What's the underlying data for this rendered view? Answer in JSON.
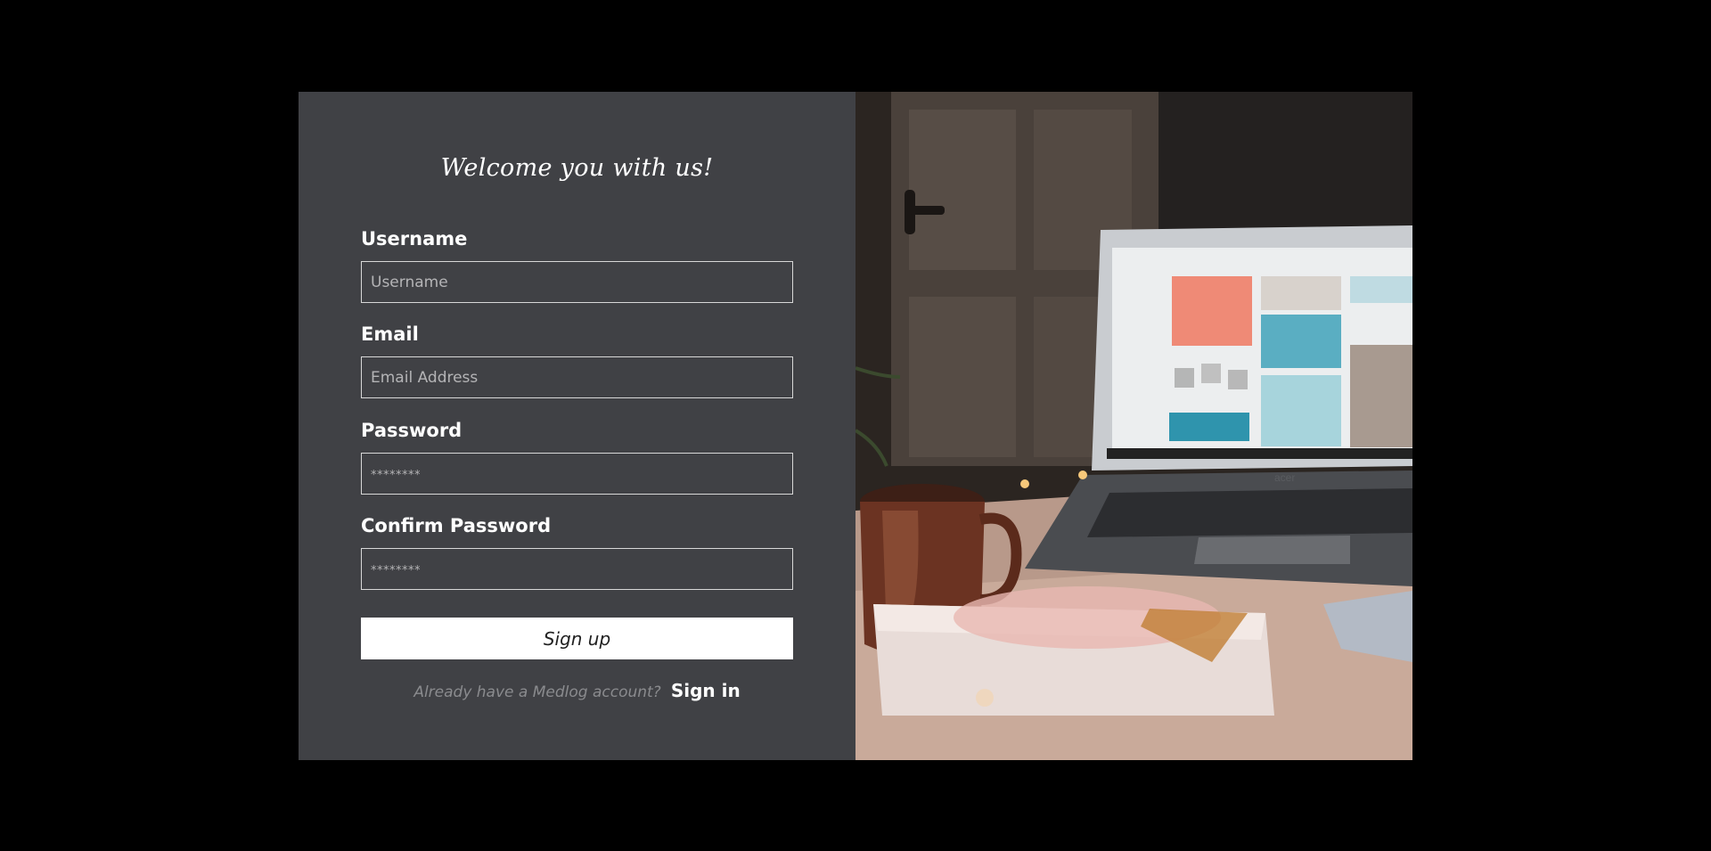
{
  "form": {
    "heading": "Welcome you with us!",
    "fields": [
      {
        "label": "Username",
        "placeholder": "Username",
        "type": "text"
      },
      {
        "label": "Email",
        "placeholder": "Email Address",
        "type": "email"
      },
      {
        "label": "Password",
        "placeholder": "********",
        "type": "password"
      },
      {
        "label": "Confirm Password",
        "placeholder": "********",
        "type": "password"
      }
    ],
    "submit_label": "Sign up",
    "signin_prompt": "Already have a Medlog account?",
    "signin_link": "Sign in"
  },
  "photo": {
    "laptop_brand": "acer"
  },
  "colors": {
    "page_background": "#000000",
    "form_background": "#404145",
    "button_background": "#ffffff",
    "text_primary": "#ffffff",
    "text_muted": "#8a8b8e"
  }
}
